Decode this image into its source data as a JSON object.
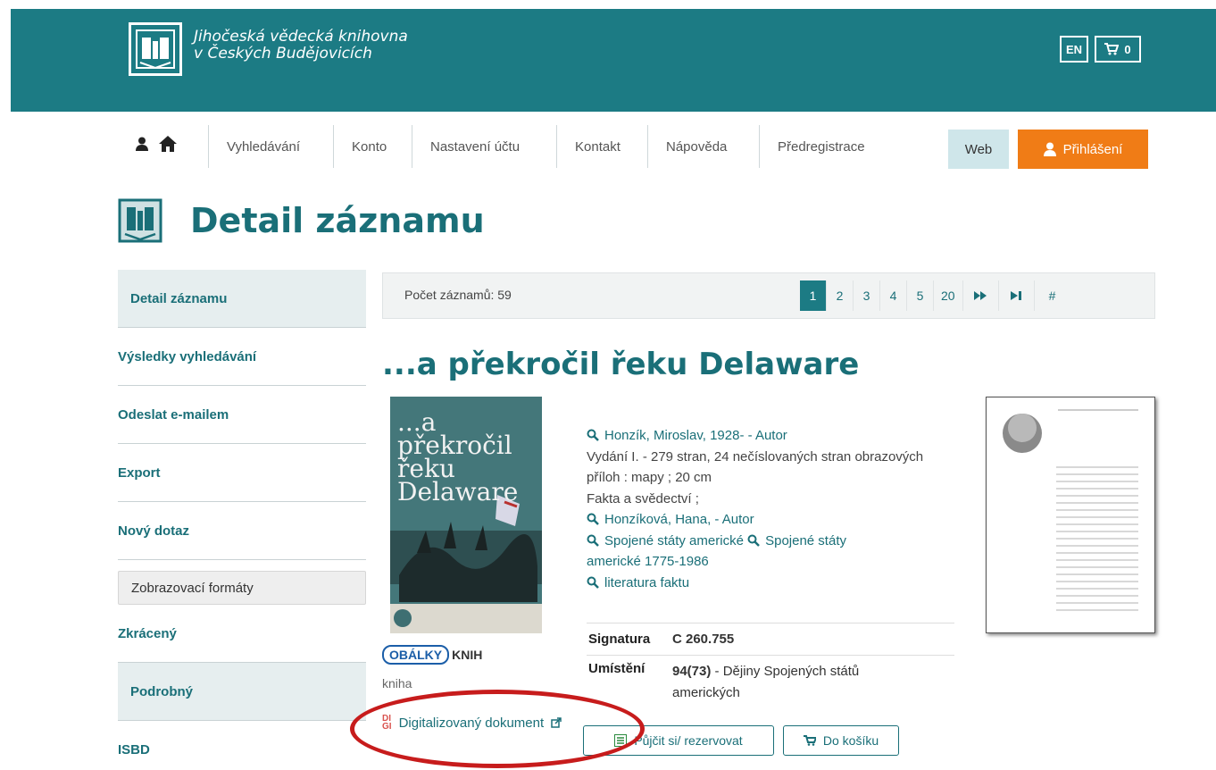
{
  "header": {
    "logo_line1": "Jihočeská vědecká knihovna",
    "logo_line2": "v Českých Budějovicích",
    "lang_button": "EN",
    "cart_count": "0"
  },
  "nav": {
    "items": [
      "Vyhledávání",
      "Konto",
      "Nastavení účtu",
      "Kontakt",
      "Nápověda",
      "Předregistrace"
    ],
    "web_label": "Web",
    "login_label": "Přihlášení"
  },
  "page_title": "Detail záznamu",
  "sidebar": {
    "items": [
      "Detail záznamu",
      "Výsledky vyhledávání",
      "Odeslat e-mailem",
      "Export",
      "Nový dotaz"
    ],
    "formats_heading": "Zobrazovací formáty",
    "formats": [
      "Zkrácený",
      "Podrobný",
      "ISBD"
    ]
  },
  "results": {
    "count_label": "Počet záznamů: 59",
    "pages": [
      "1",
      "2",
      "3",
      "4",
      "5",
      "20"
    ],
    "active_page": "1",
    "last_symbol": "#"
  },
  "record": {
    "title": "...a překročil řeku Delaware",
    "cover_title": "...a překročil řeku Delaware",
    "cover_source_a": "OBÁLKY",
    "cover_source_b": "KNIH",
    "doc_type": "kniha",
    "digi_label": "Digitalizovaný dokument",
    "author1": "Honzík, Miroslav, 1928- - Autor",
    "edition": "Vydání I. - 279 stran, 24 nečíslovaných stran obrazových příloh : mapy ; 20 cm",
    "series": "Fakta a svědectví ;",
    "author2": "Honzíková, Hana, - Autor",
    "subject1": "Spojené státy americké",
    "subject2a": "Spojené státy",
    "subject2b": "americké 1775-1986",
    "subject3": "literatura faktu",
    "signatura_label": "Signatura",
    "signatura_value": "C 260.755",
    "umisteni_label": "Umístění",
    "umisteni_code": "94(73)",
    "umisteni_text": " - Dějiny Spojených států",
    "umisteni_text2": "amerických",
    "borrow_label": "Půjčit si/ rezervovat",
    "basket_label": "Do košíku"
  },
  "colors": {
    "brand_teal": "#1c7b84",
    "login_orange": "#f07c16",
    "annotation_red": "#c71c1c"
  }
}
